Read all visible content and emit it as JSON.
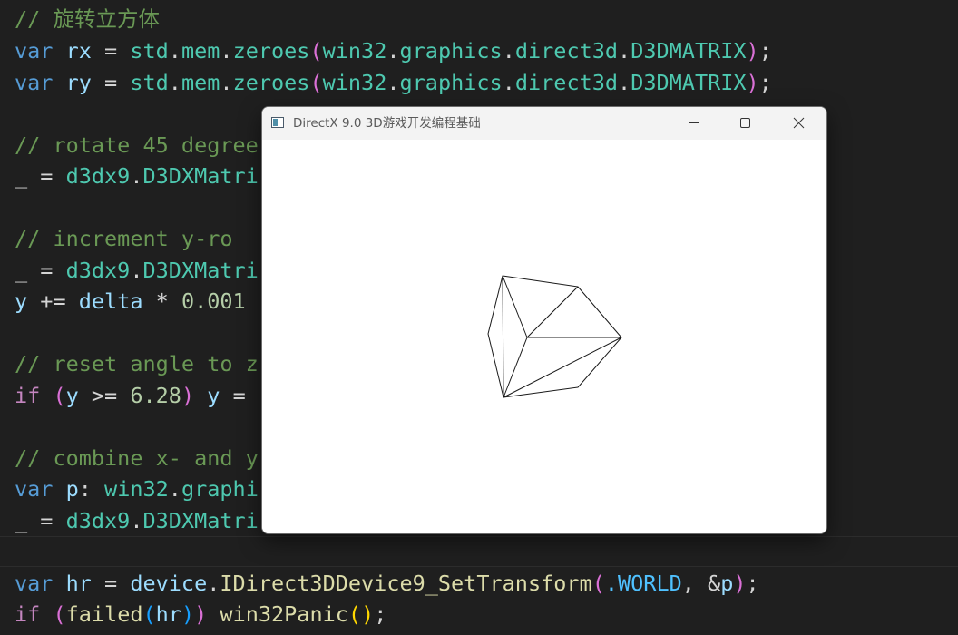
{
  "editor": {
    "lines": [
      {
        "tokens": [
          {
            "t": "// 旋转立方体",
            "c": "comment"
          }
        ]
      },
      {
        "tokens": [
          {
            "t": "var ",
            "c": "kw"
          },
          {
            "t": "rx",
            "c": "var"
          },
          {
            "t": " = ",
            "c": "plain"
          },
          {
            "t": "std",
            "c": "fn"
          },
          {
            "t": ".",
            "c": "plain"
          },
          {
            "t": "mem",
            "c": "fn"
          },
          {
            "t": ".",
            "c": "plain"
          },
          {
            "t": "zeroes",
            "c": "fn"
          },
          {
            "t": "(",
            "c": "p1"
          },
          {
            "t": "win32",
            "c": "fn"
          },
          {
            "t": ".",
            "c": "plain"
          },
          {
            "t": "graphics",
            "c": "fn"
          },
          {
            "t": ".",
            "c": "plain"
          },
          {
            "t": "direct3d",
            "c": "fn"
          },
          {
            "t": ".",
            "c": "plain"
          },
          {
            "t": "D3DMATRIX",
            "c": "fn"
          },
          {
            "t": ")",
            "c": "p1"
          },
          {
            "t": ";",
            "c": "plain"
          }
        ]
      },
      {
        "tokens": [
          {
            "t": "var ",
            "c": "kw"
          },
          {
            "t": "ry",
            "c": "var"
          },
          {
            "t": " = ",
            "c": "plain"
          },
          {
            "t": "std",
            "c": "fn"
          },
          {
            "t": ".",
            "c": "plain"
          },
          {
            "t": "mem",
            "c": "fn"
          },
          {
            "t": ".",
            "c": "plain"
          },
          {
            "t": "zeroes",
            "c": "fn"
          },
          {
            "t": "(",
            "c": "p1"
          },
          {
            "t": "win32",
            "c": "fn"
          },
          {
            "t": ".",
            "c": "plain"
          },
          {
            "t": "graphics",
            "c": "fn"
          },
          {
            "t": ".",
            "c": "plain"
          },
          {
            "t": "direct3d",
            "c": "fn"
          },
          {
            "t": ".",
            "c": "plain"
          },
          {
            "t": "D3DMATRIX",
            "c": "fn"
          },
          {
            "t": ")",
            "c": "p1"
          },
          {
            "t": ";",
            "c": "plain"
          }
        ]
      },
      {
        "tokens": []
      },
      {
        "tokens": [
          {
            "t": "// rotate 45 degree",
            "c": "comment"
          }
        ]
      },
      {
        "tokens": [
          {
            "t": "_ = ",
            "c": "plain"
          },
          {
            "t": "d3dx9",
            "c": "fn"
          },
          {
            "t": ".",
            "c": "plain"
          },
          {
            "t": "D3DXMatri",
            "c": "fn"
          }
        ]
      },
      {
        "tokens": []
      },
      {
        "tokens": [
          {
            "t": "// increment y-ro",
            "c": "comment"
          }
        ]
      },
      {
        "tokens": [
          {
            "t": "_ = ",
            "c": "plain"
          },
          {
            "t": "d3dx9",
            "c": "fn"
          },
          {
            "t": ".",
            "c": "plain"
          },
          {
            "t": "D3DXMatri",
            "c": "fn"
          }
        ]
      },
      {
        "tokens": [
          {
            "t": "y",
            "c": "var"
          },
          {
            "t": " += ",
            "c": "plain"
          },
          {
            "t": "delta",
            "c": "var"
          },
          {
            "t": " * ",
            "c": "plain"
          },
          {
            "t": "0.001",
            "c": "num"
          }
        ]
      },
      {
        "tokens": []
      },
      {
        "tokens": [
          {
            "t": "// reset angle to z",
            "c": "comment"
          }
        ]
      },
      {
        "tokens": [
          {
            "t": "if ",
            "c": "ctrl"
          },
          {
            "t": "(",
            "c": "p1"
          },
          {
            "t": "y",
            "c": "var"
          },
          {
            "t": " >= ",
            "c": "plain"
          },
          {
            "t": "6.28",
            "c": "num"
          },
          {
            "t": ")",
            "c": "p1"
          },
          {
            "t": " ",
            "c": "plain"
          },
          {
            "t": "y",
            "c": "var"
          },
          {
            "t": " =",
            "c": "plain"
          }
        ]
      },
      {
        "tokens": []
      },
      {
        "tokens": [
          {
            "t": "// combine x- and y",
            "c": "comment"
          }
        ]
      },
      {
        "tokens": [
          {
            "t": "var ",
            "c": "kw"
          },
          {
            "t": "p",
            "c": "var"
          },
          {
            "t": ": ",
            "c": "plain"
          },
          {
            "t": "win32",
            "c": "fn"
          },
          {
            "t": ".",
            "c": "plain"
          },
          {
            "t": "graphi",
            "c": "fn"
          }
        ]
      },
      {
        "tokens": [
          {
            "t": "_ = ",
            "c": "plain"
          },
          {
            "t": "d3dx9",
            "c": "fn"
          },
          {
            "t": ".",
            "c": "plain"
          },
          {
            "t": "D3DXMatri",
            "c": "fn"
          }
        ]
      },
      {
        "tokens": []
      },
      {
        "tokens": [
          {
            "t": "var ",
            "c": "kw"
          },
          {
            "t": "hr",
            "c": "var"
          },
          {
            "t": " = ",
            "c": "plain"
          },
          {
            "t": "device",
            "c": "var"
          },
          {
            "t": ".",
            "c": "plain"
          },
          {
            "t": "IDirect3DDevice9_SetTransform",
            "c": "fn2"
          },
          {
            "t": "(",
            "c": "p1"
          },
          {
            "t": ".WORLD",
            "c": "enum"
          },
          {
            "t": ", ",
            "c": "plain"
          },
          {
            "t": "&",
            "c": "plain"
          },
          {
            "t": "p",
            "c": "var"
          },
          {
            "t": ")",
            "c": "p1"
          },
          {
            "t": ";",
            "c": "plain"
          }
        ]
      },
      {
        "tokens": [
          {
            "t": "if ",
            "c": "ctrl"
          },
          {
            "t": "(",
            "c": "p1"
          },
          {
            "t": "failed",
            "c": "fn2"
          },
          {
            "t": "(",
            "c": "p2"
          },
          {
            "t": "hr",
            "c": "var"
          },
          {
            "t": ")",
            "c": "p2"
          },
          {
            "t": ")",
            "c": "p1"
          },
          {
            "t": " ",
            "c": "plain"
          },
          {
            "t": "win32Panic",
            "c": "fn2"
          },
          {
            "t": "(",
            "c": "p3"
          },
          {
            "t": ")",
            "c": "p3"
          },
          {
            "t": ";",
            "c": "plain"
          }
        ]
      }
    ]
  },
  "window": {
    "title": "DirectX 9.0 3D游戏开发编程基础",
    "icon": "app-window-icon",
    "buttons": [
      "minimize-icon",
      "maximize-icon",
      "close-icon"
    ]
  },
  "colors": {
    "editor_bg": "#1f1f1f",
    "window_bg": "#ffffff",
    "titlebar_bg": "#f3f3f3",
    "wireframe": "#1a1a1a"
  }
}
